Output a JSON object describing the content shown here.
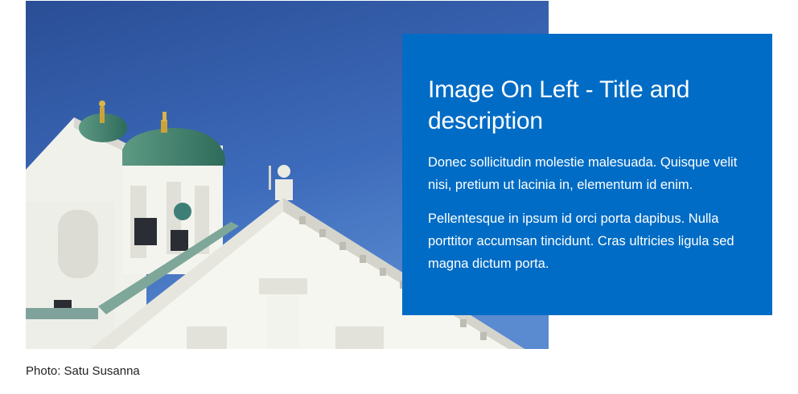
{
  "card": {
    "title": "Image On Left - Title and description",
    "paragraphs": [
      "Donec sollicitudin molestie malesuada. Quisque velit nisi, pretium ut lacinia in, elementum id enim.",
      "Pellentesque in ipsum id orci porta dapibus. Nulla porttitor accumsan tincidunt. Cras ultricies ligula sed magna dictum porta."
    ],
    "background_color": "#006cc5",
    "text_color": "#ffffff"
  },
  "image": {
    "subject": "white-cathedral-with-green-domes-photo",
    "sky_color": "#3a64b2"
  },
  "caption": {
    "text": "Photo: Satu Susanna"
  }
}
